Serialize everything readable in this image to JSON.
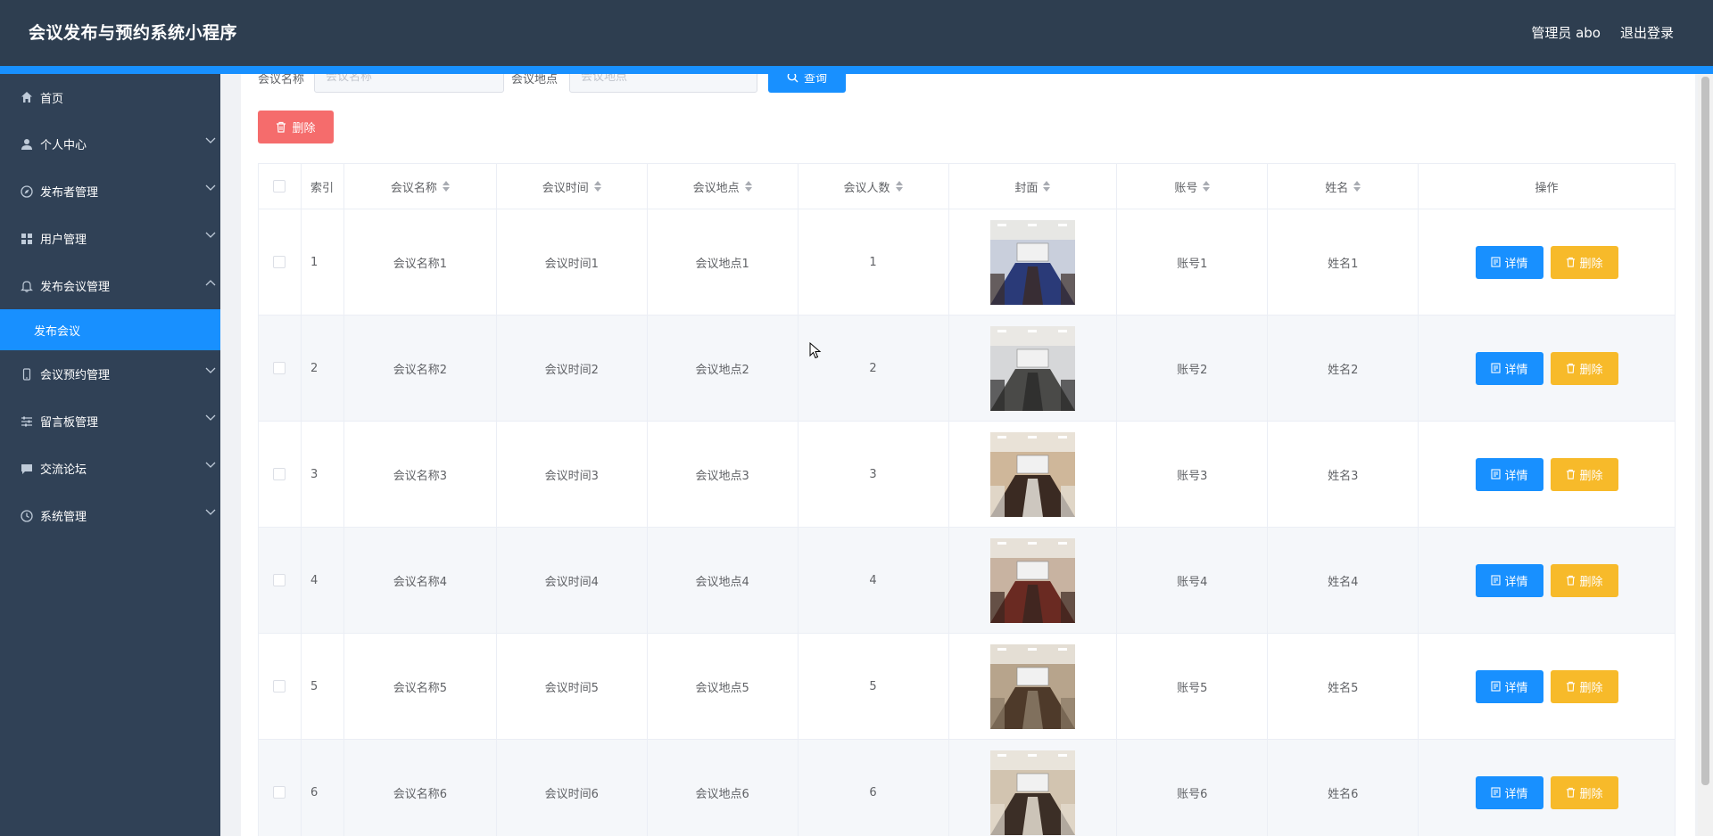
{
  "header": {
    "title": "会议发布与预约系统小程序",
    "user": "管理员 abo",
    "logout": "退出登录"
  },
  "sidebar": {
    "items": [
      {
        "label": "首页",
        "icon": "home-icon"
      },
      {
        "label": "个人中心",
        "icon": "user-icon"
      },
      {
        "label": "发布者管理",
        "icon": "compass-icon"
      },
      {
        "label": "用户管理",
        "icon": "grid-icon"
      },
      {
        "label": "发布会议管理",
        "icon": "bell-icon"
      },
      {
        "label": "会议预约管理",
        "icon": "phone-icon"
      },
      {
        "label": "留言板管理",
        "icon": "sliders-icon"
      },
      {
        "label": "交流论坛",
        "icon": "chat-icon"
      },
      {
        "label": "系统管理",
        "icon": "clock-icon"
      }
    ],
    "active_sub": "发布会议"
  },
  "search": {
    "name_label": "会议名称",
    "name_placeholder": "会议名称",
    "location_label": "会议地点",
    "location_placeholder": "会议地点",
    "query_label": "查询"
  },
  "toolbar": {
    "delete_label": "删除"
  },
  "table": {
    "headers": {
      "index": "索引",
      "name": "会议名称",
      "time": "会议时间",
      "location": "会议地点",
      "count": "会议人数",
      "cover": "封面",
      "account": "账号",
      "username": "姓名",
      "ops": "操作"
    },
    "rows": [
      {
        "index": "1",
        "name": "会议名称1",
        "time": "会议时间1",
        "location": "会议地点1",
        "count": "1",
        "account": "账号1",
        "username": "姓名1"
      },
      {
        "index": "2",
        "name": "会议名称2",
        "time": "会议时间2",
        "location": "会议地点2",
        "count": "2",
        "account": "账号2",
        "username": "姓名2"
      },
      {
        "index": "3",
        "name": "会议名称3",
        "time": "会议时间3",
        "location": "会议地点3",
        "count": "3",
        "account": "账号3",
        "username": "姓名3"
      },
      {
        "index": "4",
        "name": "会议名称4",
        "time": "会议时间4",
        "location": "会议地点4",
        "count": "4",
        "account": "账号4",
        "username": "姓名4"
      },
      {
        "index": "5",
        "name": "会议名称5",
        "time": "会议时间5",
        "location": "会议地点5",
        "count": "5",
        "account": "账号5",
        "username": "姓名5"
      },
      {
        "index": "6",
        "name": "会议名称6",
        "time": "会议时间6",
        "location": "会议地点6",
        "count": "6",
        "account": "账号6",
        "username": "姓名6"
      }
    ],
    "detail_label": "详情",
    "delete_label": "删除"
  },
  "colors": {
    "header_bg": "#2e3e50",
    "sidebar_bg": "#304156",
    "primary": "#1890ff",
    "danger": "#f56c6c",
    "warning": "#f7ba2a"
  }
}
